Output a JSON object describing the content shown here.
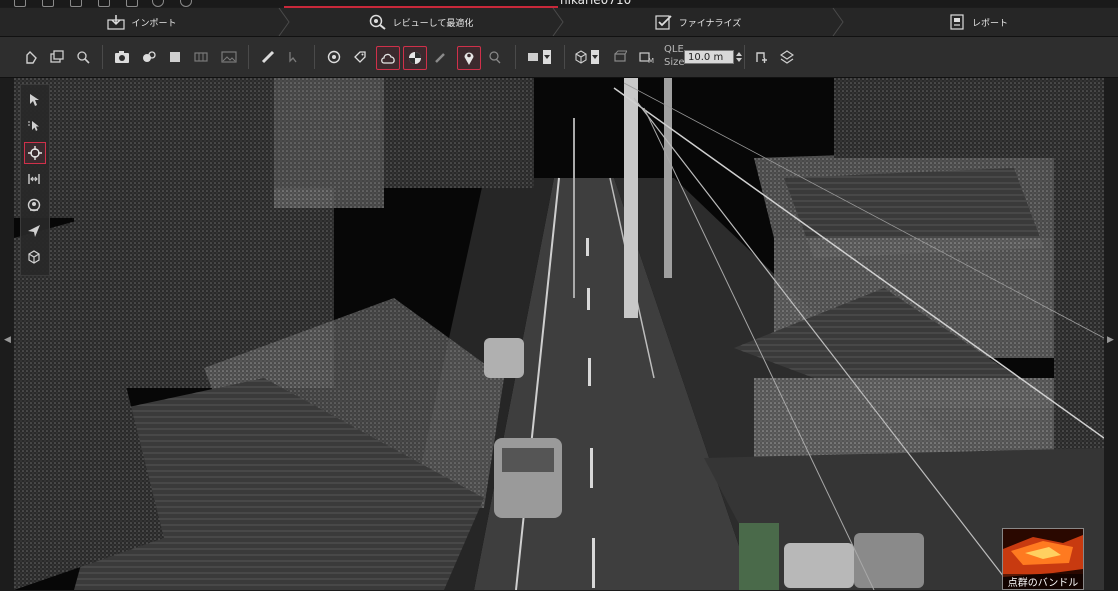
{
  "window": {
    "title": "hikarie0710"
  },
  "steps": [
    {
      "label": "インポート",
      "icon": "import-icon"
    },
    {
      "label": "レビューして最適化",
      "icon": "review-optimize-icon"
    },
    {
      "label": "ファイナライズ",
      "icon": "finalize-icon"
    },
    {
      "label": "レポート",
      "icon": "report-icon"
    }
  ],
  "toolbar": {
    "qle_label": "QLE",
    "size_label": "Size",
    "size_value": "10.0 m"
  },
  "thumbnail": {
    "label": "点群のバンドル"
  },
  "colors": {
    "accent": "#c8283a",
    "toolbar_bg": "#2e2e2e",
    "panel_bg": "#262626"
  }
}
